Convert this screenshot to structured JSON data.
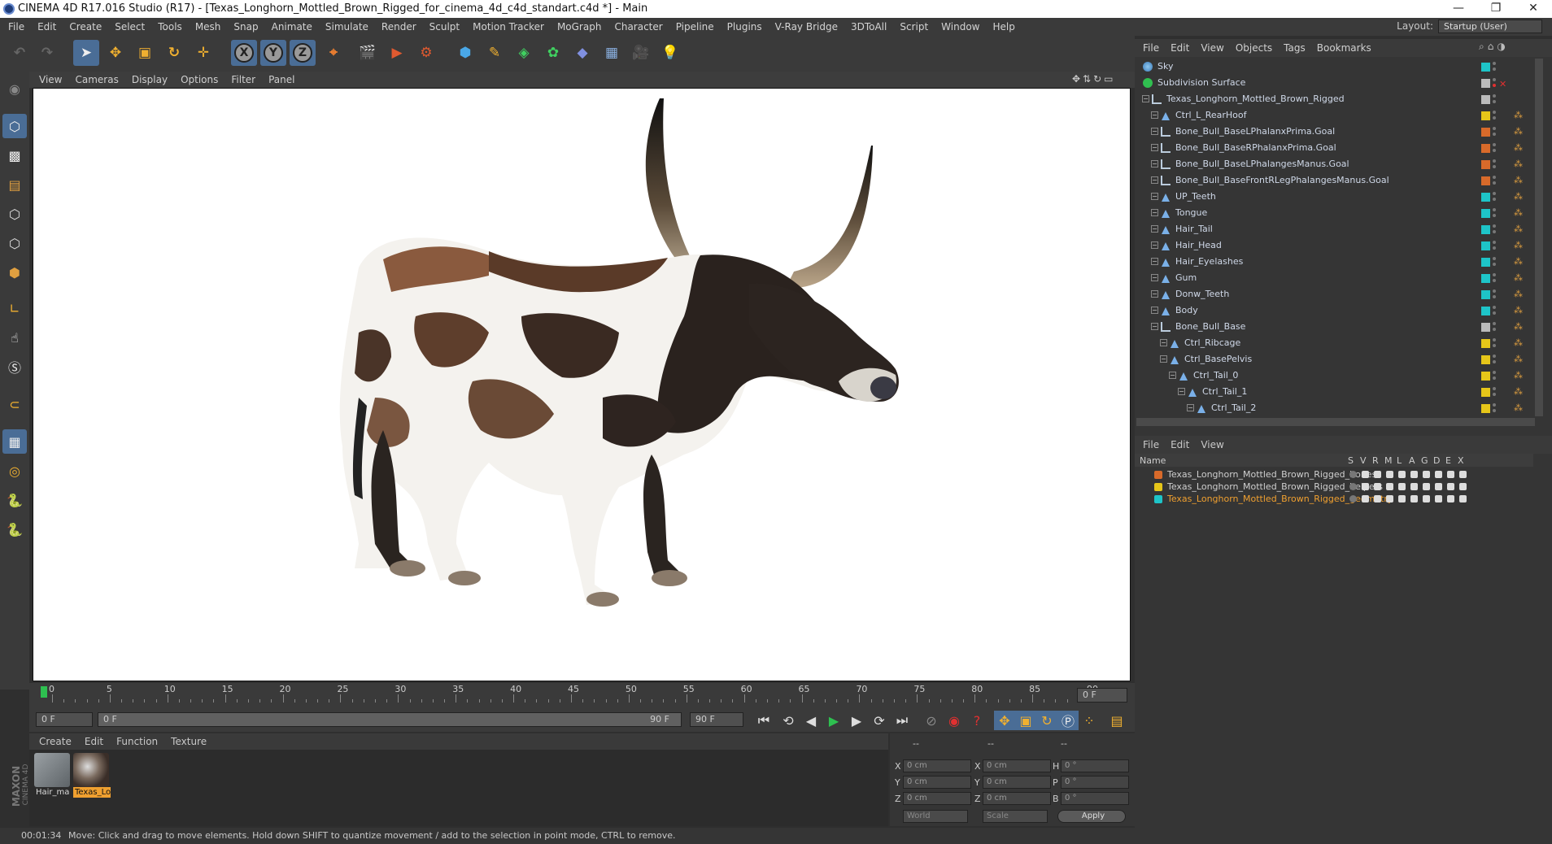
{
  "window": {
    "title": "CINEMA 4D R17.016 Studio (R17) - [Texas_Longhorn_Mottled_Brown_Rigged_for_cinema_4d_c4d_standart.c4d *] - Main",
    "controls": [
      "—",
      "❐",
      "✕"
    ]
  },
  "menubar": [
    "File",
    "Edit",
    "Create",
    "Select",
    "Tools",
    "Mesh",
    "Snap",
    "Animate",
    "Simulate",
    "Render",
    "Sculpt",
    "Motion Tracker",
    "MoGraph",
    "Character",
    "Pipeline",
    "Plugins",
    "V-Ray Bridge",
    "3DToAll",
    "Script",
    "Window",
    "Help"
  ],
  "layout": {
    "label": "Layout:",
    "value": "Startup (User)"
  },
  "toolbar": {
    "icons": [
      "undo-icon",
      "redo-icon",
      "select-arrow-icon",
      "move-icon",
      "scale-icon",
      "rotate-icon",
      "live-select-icon",
      "x-axis-icon",
      "y-axis-icon",
      "z-axis-icon",
      "coordinate-system-icon",
      "render-view-icon",
      "render-picture-viewer-icon",
      "render-settings-icon",
      "cube-icon",
      "pen-spline-icon",
      "subdivision-icon",
      "array-icon",
      "deformer-icon",
      "floor-icon",
      "camera-icon",
      "light-icon"
    ],
    "axis_labels": [
      "X",
      "Y",
      "Z"
    ]
  },
  "viewport": {
    "menu": [
      "View",
      "Cameras",
      "Display",
      "Options",
      "Filter",
      "Panel"
    ]
  },
  "timeline": {
    "ticks": [
      "0",
      "5",
      "10",
      "15",
      "20",
      "25",
      "30",
      "35",
      "40",
      "45",
      "50",
      "55",
      "60",
      "65",
      "70",
      "75",
      "80",
      "85",
      "90"
    ],
    "current_frame": "0 F"
  },
  "transport": {
    "start": "0 F",
    "range_start": "0 F",
    "range_end": "90 F",
    "end": "90 F"
  },
  "materials": {
    "menu": [
      "Create",
      "Edit",
      "Function",
      "Texture"
    ],
    "items": [
      {
        "label": "Hair_ma",
        "selected": false
      },
      {
        "label": "Texas_Lo",
        "selected": true
      }
    ]
  },
  "coordinates": {
    "headers": [
      "--",
      "--",
      "--"
    ],
    "rows": [
      {
        "a": "X",
        "av": "0 cm",
        "b": "X",
        "bv": "0 cm",
        "c": "H",
        "cv": "0 °"
      },
      {
        "a": "Y",
        "av": "0 cm",
        "b": "Y",
        "bv": "0 cm",
        "c": "P",
        "cv": "0 °"
      },
      {
        "a": "Z",
        "av": "0 cm",
        "b": "Z",
        "bv": "0 cm",
        "c": "B",
        "cv": "0 °"
      }
    ],
    "mode": "World",
    "transform": "Scale",
    "apply": "Apply"
  },
  "status": {
    "time": "00:01:34",
    "message": "Move: Click and drag to move elements. Hold down SHIFT to quantize movement / add to the selection in point mode, CTRL to remove."
  },
  "object_manager": {
    "menu": [
      "File",
      "Edit",
      "View",
      "Objects",
      "Tags",
      "Bookmarks"
    ],
    "objects": [
      {
        "name": "Sky",
        "indent": 0,
        "icon": "sky",
        "tag": "#1ec4c8",
        "x": false
      },
      {
        "name": "Subdivision Surface",
        "indent": 0,
        "icon": "subdiv",
        "tag": "#bbbbbb",
        "x": true
      },
      {
        "name": "Texas_Longhorn_Mottled_Brown_Rigged",
        "indent": 1,
        "icon": "null",
        "tag": "#bbbbbb",
        "x": false
      },
      {
        "name": "Ctrl_L_RearHoof",
        "indent": 2,
        "icon": "ctrl",
        "tag": "#e6c619",
        "x": false
      },
      {
        "name": "Bone_Bull_BaseLPhalanxPrima.Goal",
        "indent": 2,
        "icon": "null",
        "tag": "#d86a2a",
        "x": false
      },
      {
        "name": "Bone_Bull_BaseRPhalanxPrima.Goal",
        "indent": 2,
        "icon": "null",
        "tag": "#d86a2a",
        "x": false
      },
      {
        "name": "Bone_Bull_BaseLPhalangesManus.Goal",
        "indent": 2,
        "icon": "null",
        "tag": "#d86a2a",
        "x": false
      },
      {
        "name": "Bone_Bull_BaseFrontRLegPhalangesManus.Goal",
        "indent": 2,
        "icon": "null",
        "tag": "#d86a2a",
        "x": false
      },
      {
        "name": "UP_Teeth",
        "indent": 2,
        "icon": "ctrl",
        "tag": "#1ec4c8",
        "x": false
      },
      {
        "name": "Tongue",
        "indent": 2,
        "icon": "ctrl",
        "tag": "#1ec4c8",
        "x": false
      },
      {
        "name": "Hair_Tail",
        "indent": 2,
        "icon": "ctrl",
        "tag": "#1ec4c8",
        "x": false
      },
      {
        "name": "Hair_Head",
        "indent": 2,
        "icon": "ctrl",
        "tag": "#1ec4c8",
        "x": false
      },
      {
        "name": "Hair_Eyelashes",
        "indent": 2,
        "icon": "ctrl",
        "tag": "#1ec4c8",
        "x": false
      },
      {
        "name": "Gum",
        "indent": 2,
        "icon": "ctrl",
        "tag": "#1ec4c8",
        "x": false
      },
      {
        "name": "Donw_Teeth",
        "indent": 2,
        "icon": "ctrl",
        "tag": "#1ec4c8",
        "x": false
      },
      {
        "name": "Body",
        "indent": 2,
        "icon": "ctrl",
        "tag": "#1ec4c8",
        "x": false
      },
      {
        "name": "Bone_Bull_Base",
        "indent": 2,
        "icon": "null",
        "tag": "#bbbbbb",
        "x": false
      },
      {
        "name": "Ctrl_Ribcage",
        "indent": 3,
        "icon": "ctrl",
        "tag": "#e6c619",
        "x": false
      },
      {
        "name": "Ctrl_BasePelvis",
        "indent": 3,
        "icon": "ctrl",
        "tag": "#e6c619",
        "x": false
      },
      {
        "name": "Ctrl_Tail_0",
        "indent": 4,
        "icon": "ctrl",
        "tag": "#e6c619",
        "x": false
      },
      {
        "name": "Ctrl_Tail_1",
        "indent": 5,
        "icon": "ctrl",
        "tag": "#e6c619",
        "x": false
      },
      {
        "name": "Ctrl_Tail_2",
        "indent": 6,
        "icon": "ctrl",
        "tag": "#e6c619",
        "x": false
      }
    ]
  },
  "layer_manager": {
    "menu": [
      "File",
      "Edit",
      "View"
    ],
    "columns": [
      "Name",
      "S",
      "V",
      "R",
      "M",
      "L",
      "A",
      "G",
      "D",
      "E",
      "X"
    ],
    "layers": [
      {
        "name": "Texas_Longhorn_Mottled_Brown_Rigged_bones",
        "color": "#d86a2a",
        "active": false
      },
      {
        "name": "Texas_Longhorn_Mottled_Brown_Rigged_helpers",
        "color": "#e6c619",
        "active": false
      },
      {
        "name": "Texas_Longhorn_Mottled_Brown_Rigged_geometry",
        "color": "#1ec4c8",
        "active": true
      }
    ]
  }
}
